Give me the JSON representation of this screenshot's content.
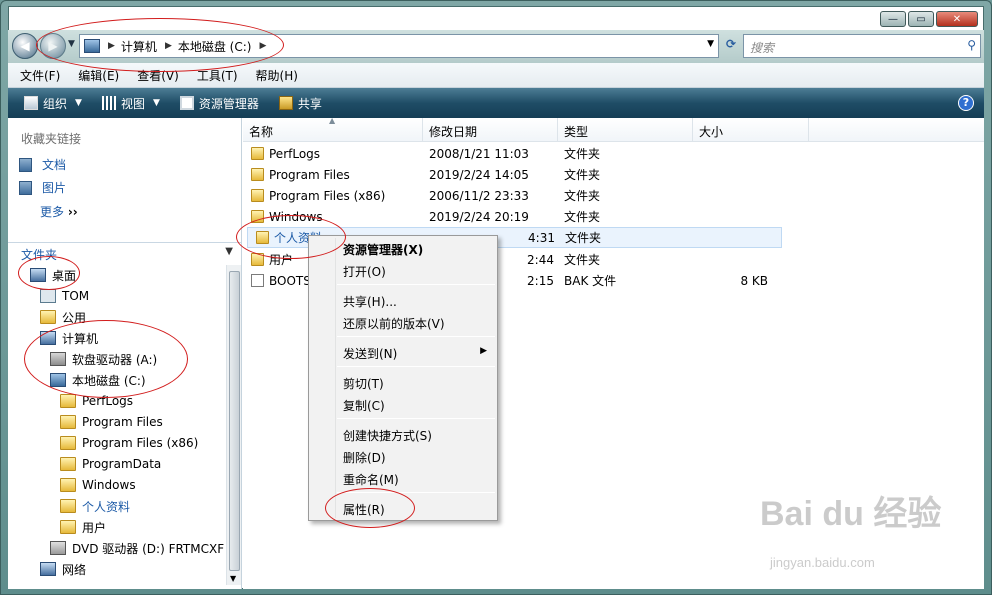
{
  "window": {
    "minimize": "—",
    "maximize": "▭",
    "close": "✕"
  },
  "address": {
    "crumbs": [
      "计算机",
      "本地磁盘 (C:)"
    ],
    "search_placeholder": "搜索"
  },
  "menubar": [
    "文件(F)",
    "编辑(E)",
    "查看(V)",
    "工具(T)",
    "帮助(H)"
  ],
  "toolbar": {
    "organize": "组织",
    "views": "视图",
    "explorer": "资源管理器",
    "share": "共享"
  },
  "left": {
    "favorites_title": "收藏夹链接",
    "favorites": [
      "文档",
      "图片"
    ],
    "more": "更多",
    "folders_title": "文件夹",
    "tree": [
      {
        "label": "桌面",
        "icon": "desktop-icon"
      },
      {
        "label": "TOM",
        "icon": "user-folder-icon"
      },
      {
        "label": "公用",
        "icon": "folder-icon"
      },
      {
        "label": "计算机",
        "icon": "computer-icon"
      },
      {
        "label": "软盘驱动器 (A:)",
        "icon": "floppy-drive-icon"
      },
      {
        "label": "本地磁盘 (C:)",
        "icon": "local-disk-icon"
      },
      {
        "label": "PerfLogs",
        "icon": "folder-icon"
      },
      {
        "label": "Program Files",
        "icon": "folder-icon"
      },
      {
        "label": "Program Files (x86)",
        "icon": "folder-icon"
      },
      {
        "label": "ProgramData",
        "icon": "folder-icon"
      },
      {
        "label": "Windows",
        "icon": "folder-icon"
      },
      {
        "label": "个人资料",
        "icon": "folder-icon"
      },
      {
        "label": "用户",
        "icon": "folder-icon"
      },
      {
        "label": "DVD 驱动器 (D:) FRTMCXF",
        "icon": "dvd-drive-icon"
      },
      {
        "label": "网络",
        "icon": "network-icon"
      }
    ]
  },
  "columns": {
    "name": "名称",
    "date": "修改日期",
    "type": "类型",
    "size": "大小"
  },
  "files": [
    {
      "name": "PerfLogs",
      "date": "2008/1/21 11:03",
      "type": "文件夹",
      "size": ""
    },
    {
      "name": "Program Files",
      "date": "2019/2/24 14:05",
      "type": "文件夹",
      "size": ""
    },
    {
      "name": "Program Files (x86)",
      "date": "2006/11/2 23:33",
      "type": "文件夹",
      "size": ""
    },
    {
      "name": "Windows",
      "date": "2019/2/24 20:19",
      "type": "文件夹",
      "size": ""
    },
    {
      "name": "个人资料",
      "date": "4:31",
      "type": "文件夹",
      "size": ""
    },
    {
      "name": "用户",
      "date": "2:44",
      "type": "文件夹",
      "size": ""
    },
    {
      "name": "BOOTS",
      "date": "2:15",
      "type": "BAK 文件",
      "size": "8 KB"
    }
  ],
  "context_menu": {
    "explorer": "资源管理器(X)",
    "open": "打开(O)",
    "share": "共享(H)...",
    "restore": "还原以前的版本(V)",
    "sendto": "发送到(N)",
    "cut": "剪切(T)",
    "copy": "复制(C)",
    "shortcut": "创建快捷方式(S)",
    "delete": "删除(D)",
    "rename": "重命名(M)",
    "properties": "属性(R)"
  },
  "colors": {
    "annotation": "#d21d1d",
    "toolbar": "#1f4d66",
    "link": "#1d5ba7"
  }
}
